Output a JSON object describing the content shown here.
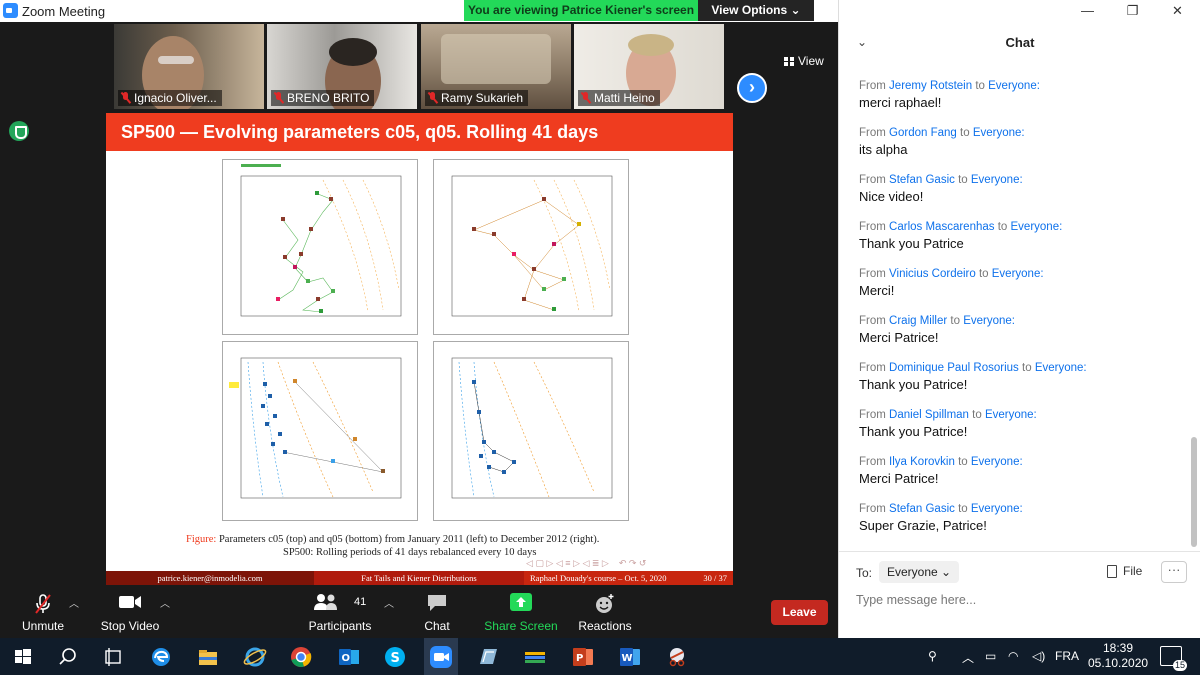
{
  "window": {
    "title": "Zoom Meeting"
  },
  "banner": {
    "viewing": "You are viewing Patrice Kiener's screen",
    "view_options": "View Options"
  },
  "gallery": {
    "view_label": "View",
    "tiles": [
      {
        "name": "Ignacio Oliver..."
      },
      {
        "name": "BRENO BRITO"
      },
      {
        "name": "Ramy Sukarieh"
      },
      {
        "name": "Matti Heino"
      }
    ]
  },
  "slide": {
    "title": "SP500 — Evolving parameters c05, q05. Rolling 41 days",
    "caption_label": "Figure:",
    "caption_line1": "Parameters c05 (top) and q05 (bottom) from January 2011 (left) to December 2012 (right).",
    "caption_line2": "SP500: Rolling periods of 41 days rebalanced every 10 days",
    "footer_author": "patrice.kiener@inmodelia.com",
    "footer_topic": "Fat Tails and Kiener Distributions",
    "footer_course": "Raphael Douady's course – Oct. 5, 2020",
    "footer_page": "30 / 37",
    "panels": [
      {
        "header": "d, 1/k, c05 – SP500 – 41 days",
        "dates": "2011-01-03 – 2011-12-29"
      },
      {
        "header": "d, 1/k, c05 – SP500 – 41 days",
        "dates": "2012-01-04 – 2012-12-31"
      },
      {
        "header": "g, c05, q05 – SP500 – 41 days",
        "dates": "2011-01-03 – 2011-12-22"
      },
      {
        "header": "g, c05, q05 – SP500 – 41 days",
        "dates": "2012-01-04 – 2012-12-31"
      }
    ]
  },
  "toolbar": {
    "unmute": "Unmute",
    "stop_video": "Stop Video",
    "participants": "Participants",
    "participants_count": "41",
    "chat": "Chat",
    "share_screen": "Share Screen",
    "reactions": "Reactions",
    "leave": "Leave"
  },
  "chat": {
    "title": "Chat",
    "messages": [
      {
        "from": "Jeremy Rotstein",
        "to": "Everyone:",
        "text": "merci raphael!"
      },
      {
        "from": "Gordon Fang",
        "to": "Everyone:",
        "text": "its alpha"
      },
      {
        "from": "Stefan Gasic",
        "to": "Everyone:",
        "text": "Nice video!"
      },
      {
        "from": "Carlos Mascarenhas",
        "to": "Everyone:",
        "text": "Thank you Patrice"
      },
      {
        "from": "Vinicius Cordeiro",
        "to": "Everyone:",
        "text": "Merci!"
      },
      {
        "from": "Craig Miller",
        "to": "Everyone:",
        "text": "Merci Patrice!"
      },
      {
        "from": "Dominique Paul Rosorius",
        "to": "Everyone:",
        "text": "Thank you Patrice!"
      },
      {
        "from": "Daniel Spillman",
        "to": "Everyone:",
        "text": "Thank you Patrice!"
      },
      {
        "from": "Ilya Korovkin",
        "to": "Everyone:",
        "text": "Merci Patrice!"
      },
      {
        "from": "Stefan Gasic",
        "to": "Everyone:",
        "text": "Super Grazie, Patrice!"
      }
    ],
    "from_word": "From",
    "to_word": "to",
    "to_label": "To:",
    "recipient": "Everyone",
    "file_label": "File",
    "more_label": "···",
    "input_placeholder": "Type message here..."
  },
  "taskbar": {
    "language": "FRA",
    "time": "18:39",
    "date": "05.10.2020",
    "notifications": "15"
  },
  "colors": {
    "zoom_blue": "#2d8cff",
    "banner_green": "#23d959",
    "slide_red": "#ef3c1f",
    "leave_red": "#c42920",
    "link_blue": "#0e71eb"
  }
}
